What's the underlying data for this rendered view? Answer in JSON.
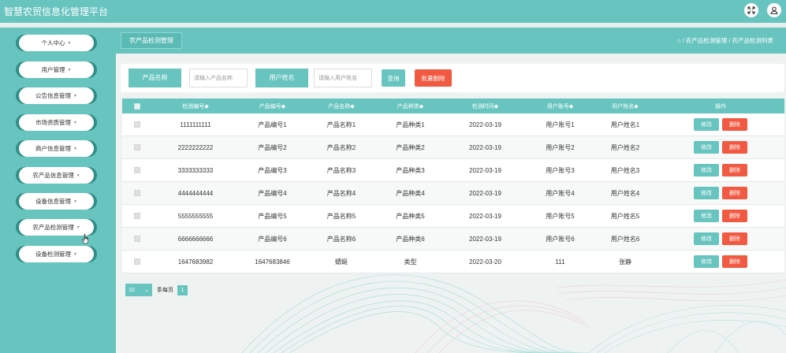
{
  "app": {
    "title": "智慧农贸信息化管理平台"
  },
  "sidebar": {
    "items": [
      {
        "label": "个人中心"
      },
      {
        "label": "用户管理"
      },
      {
        "label": "公告信息管理"
      },
      {
        "label": "市场资质管理"
      },
      {
        "label": "商户信息管理"
      },
      {
        "label": "农产品信息管理"
      },
      {
        "label": "设备信息管理"
      },
      {
        "label": "农产品检测管理"
      },
      {
        "label": "设备检测管理"
      }
    ],
    "caret": "▼"
  },
  "header": {
    "page_title": "农产品检测管理",
    "home_icon": "home-icon",
    "breadcrumb": "/ 农产品检测管理 / 农产品检测列表"
  },
  "search": {
    "product_name_label": "产品名称",
    "product_name_placeholder": "请输入产品名称",
    "user_name_label": "用户姓名",
    "user_name_placeholder": "请输入用户姓名",
    "query_label": "查询",
    "batch_delete_label": "批量删除"
  },
  "table": {
    "headers": [
      "检测编号",
      "产品编号",
      "产品名称",
      "产品种类",
      "检测时间",
      "用户账号",
      "用户姓名",
      "操作"
    ],
    "sort_marker": "◆",
    "edit_label": "修改",
    "delete_label": "删除",
    "rows": [
      [
        "1111111111",
        "产品编号1",
        "产品名称1",
        "产品种类1",
        "2022-03-19",
        "用户账号1",
        "用户姓名1"
      ],
      [
        "2222222222",
        "产品编号2",
        "产品名称2",
        "产品种类2",
        "2022-03-19",
        "用户账号2",
        "用户姓名2"
      ],
      [
        "3333333333",
        "产品编号3",
        "产品名称3",
        "产品种类3",
        "2022-03-19",
        "用户账号3",
        "用户姓名3"
      ],
      [
        "4444444444",
        "产品编号4",
        "产品名称4",
        "产品种类4",
        "2022-03-19",
        "用户账号4",
        "用户姓名4"
      ],
      [
        "5555555555",
        "产品编号5",
        "产品名称5",
        "产品种类5",
        "2022-03-19",
        "用户账号5",
        "用户姓名5"
      ],
      [
        "6666666666",
        "产品编号6",
        "产品名称6",
        "产品种类6",
        "2022-03-19",
        "用户账号6",
        "用户姓名6"
      ],
      [
        "1647683982",
        "1647683846",
        "蜻蜓",
        "类型",
        "2022-03-20",
        "111",
        "张静"
      ]
    ]
  },
  "pagination": {
    "page_size": "10",
    "per_page_label": "条每页",
    "current_page": "1"
  },
  "colors": {
    "primary": "#68c4bf",
    "danger": "#f15a42",
    "sidebar_accent": "#2f8e87"
  }
}
